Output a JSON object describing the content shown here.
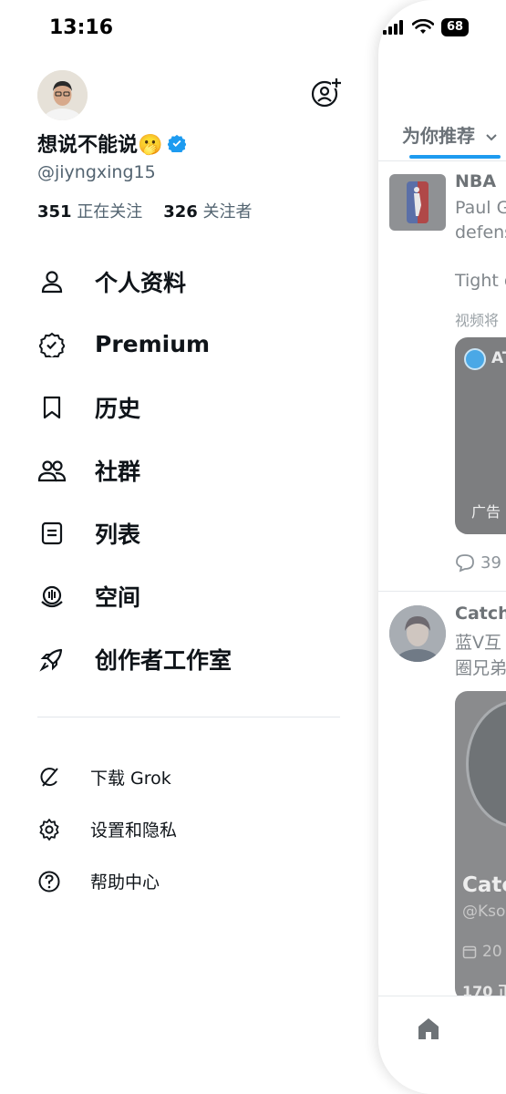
{
  "status_bar": {
    "time": "13:16",
    "battery": "68"
  },
  "profile": {
    "display_name": "想说不能说🫢",
    "handle": "@jiyngxing15",
    "following_count": "351",
    "following_label": "正在关注",
    "followers_count": "326",
    "followers_label": "关注者"
  },
  "menu": [
    {
      "label": "个人资料",
      "icon": "person-icon"
    },
    {
      "label": "Premium",
      "icon": "premium-badge-icon"
    },
    {
      "label": "历史",
      "icon": "bookmark-icon"
    },
    {
      "label": "社群",
      "icon": "communities-icon"
    },
    {
      "label": "列表",
      "icon": "list-icon"
    },
    {
      "label": "空间",
      "icon": "spaces-icon"
    },
    {
      "label": "创作者工作室",
      "icon": "rocket-icon"
    }
  ],
  "submenu": [
    {
      "label": "下载 Grok",
      "icon": "grok-icon"
    },
    {
      "label": "设置和隐私",
      "icon": "gear-icon"
    },
    {
      "label": "帮助中心",
      "icon": "help-icon"
    }
  ],
  "feed": {
    "tab_label": "为你推荐",
    "post1": {
      "author": "NBA",
      "line1": "Paul G",
      "line2": "defens",
      "line3": "Tight c",
      "line4": "视频将",
      "media_badge_text": "AT",
      "ad_label": "广告",
      "reply_count": "39"
    },
    "post2": {
      "author": "Catch",
      "line1": "蓝V互",
      "line2": "圈兄弟",
      "card_name": "Catc",
      "card_handle": "@Kso",
      "card_date": "20",
      "card_stat": "170 正"
    }
  },
  "colors": {
    "accent": "#1d9bf0",
    "secondary_text": "#536471"
  }
}
